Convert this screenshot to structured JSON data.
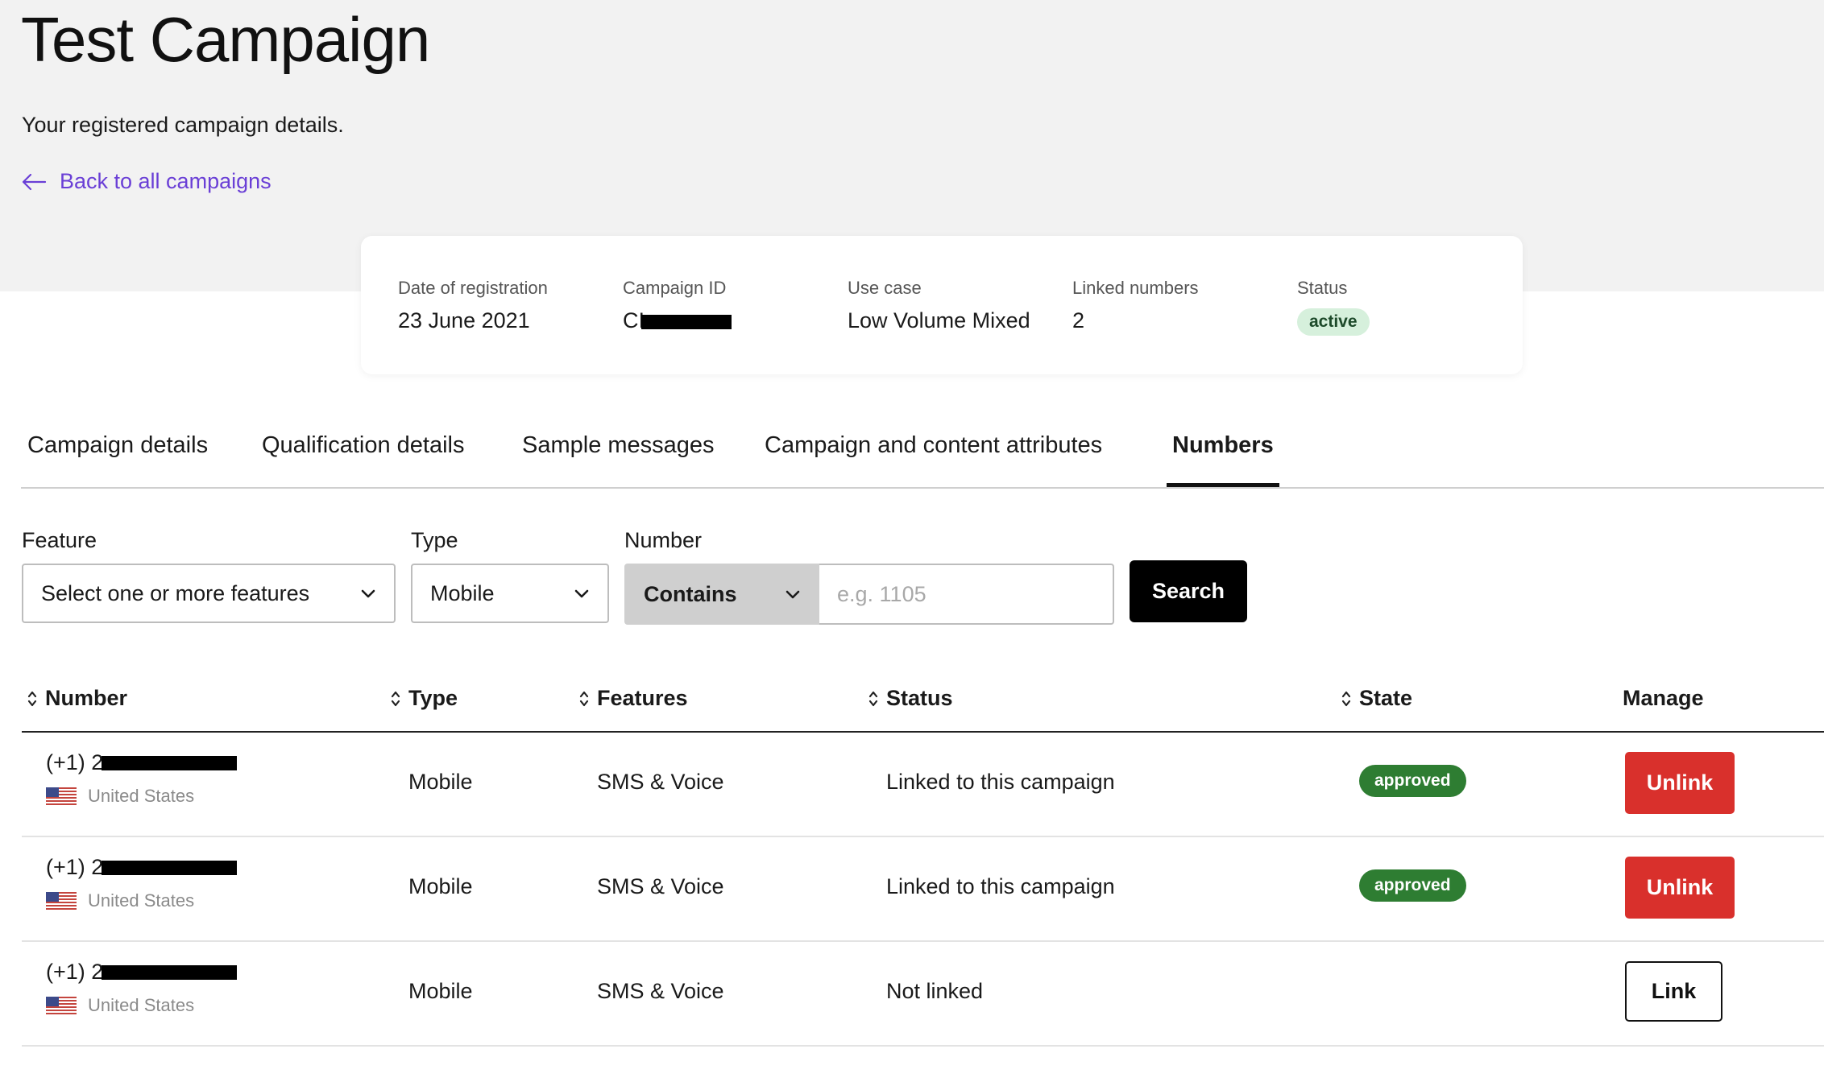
{
  "header": {
    "title": "Test Campaign",
    "subtitle": "Your registered campaign details.",
    "back_link": "Back to all campaigns"
  },
  "summary": {
    "date_label": "Date of registration",
    "date_value": "23 June 2021",
    "campaign_id_label": "Campaign ID",
    "campaign_id_value": "CI",
    "use_case_label": "Use case",
    "use_case_value": "Low Volume Mixed",
    "linked_label": "Linked numbers",
    "linked_value": "2",
    "status_label": "Status",
    "status_value": "active"
  },
  "tabs": [
    {
      "label": "Campaign details"
    },
    {
      "label": "Qualification details"
    },
    {
      "label": "Sample messages"
    },
    {
      "label": "Campaign and content attributes"
    },
    {
      "label": "Numbers",
      "active": true
    }
  ],
  "filters": {
    "feature_label": "Feature",
    "feature_value": "Select one or more features",
    "type_label": "Type",
    "type_value": "Mobile",
    "number_label": "Number",
    "number_mode": "Contains",
    "number_placeholder": "e.g. 1105",
    "search_label": "Search"
  },
  "table": {
    "columns": [
      "Number",
      "Type",
      "Features",
      "Status",
      "State",
      "Manage"
    ],
    "rows": [
      {
        "number_prefix": "(+1) 2",
        "country": "United States",
        "type": "Mobile",
        "features": "SMS & Voice",
        "status": "Linked to this campaign",
        "state": "approved",
        "action": "Unlink"
      },
      {
        "number_prefix": "(+1) 2",
        "country": "United States",
        "type": "Mobile",
        "features": "SMS & Voice",
        "status": "Linked to this campaign",
        "state": "approved",
        "action": "Unlink"
      },
      {
        "number_prefix": "(+1) 2",
        "country": "United States",
        "type": "Mobile",
        "features": "SMS & Voice",
        "status": "Not linked",
        "state": "",
        "action": "Link"
      }
    ]
  },
  "colors": {
    "link_purple": "#6a3fd6",
    "approved_green": "#2e7d32",
    "active_badge_bg": "#d6f0dc",
    "unlink_red": "#d9302c"
  },
  "icons": {
    "back": "arrow-left-icon",
    "dropdown": "chevron-down-icon",
    "sort": "sort-icon",
    "flag": "us-flag-icon"
  }
}
